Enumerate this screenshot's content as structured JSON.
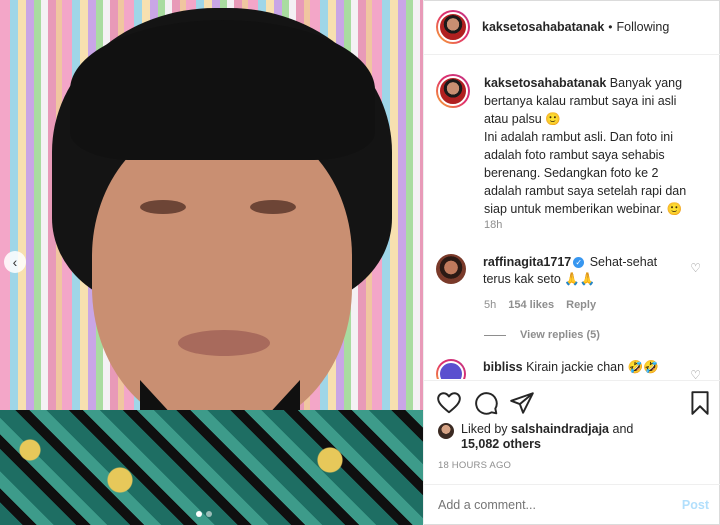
{
  "post": {
    "author": "kaksetosahabatanak",
    "separator": "•",
    "follow_state": "Following",
    "caption_text": "Banyak yang bertanya kalau rambut saya ini asli atau palsu 🙂\nIni adalah rambut asli. Dan foto ini adalah foto rambut saya sehabis berenang. Sedangkan foto ke 2 adalah rambut saya setelah rapi dan siap untuk memberikan webinar. 🙂",
    "caption_time": "18h"
  },
  "comments": [
    {
      "user": "raffinagita1717",
      "verified_mark": "✓",
      "text": "Sehat-sehat terus kak seto 🙏🙏",
      "time": "5h",
      "likes": "154 likes",
      "reply_label": "Reply",
      "view_replies": "View replies (5)"
    },
    {
      "user": "bibliss",
      "text": "Kirain jackie chan 🤣🤣"
    }
  ],
  "likes": {
    "prefix": "Liked by",
    "user": "salshaindradjaja",
    "conjunction": "and",
    "others": "15,082 others"
  },
  "posted_time": "18 HOURS AGO",
  "add_comment": {
    "placeholder": "Add a comment...",
    "post_label": "Post"
  },
  "icons": {
    "prev": "chevron-left-icon",
    "like": "heart-icon",
    "comment": "comment-icon",
    "share": "paper-plane-icon",
    "save": "bookmark-icon"
  },
  "colors": {
    "accent_link": "#3897f0",
    "post_disabled": "#b2dffc",
    "meta_grey": "#8e8e8e"
  }
}
